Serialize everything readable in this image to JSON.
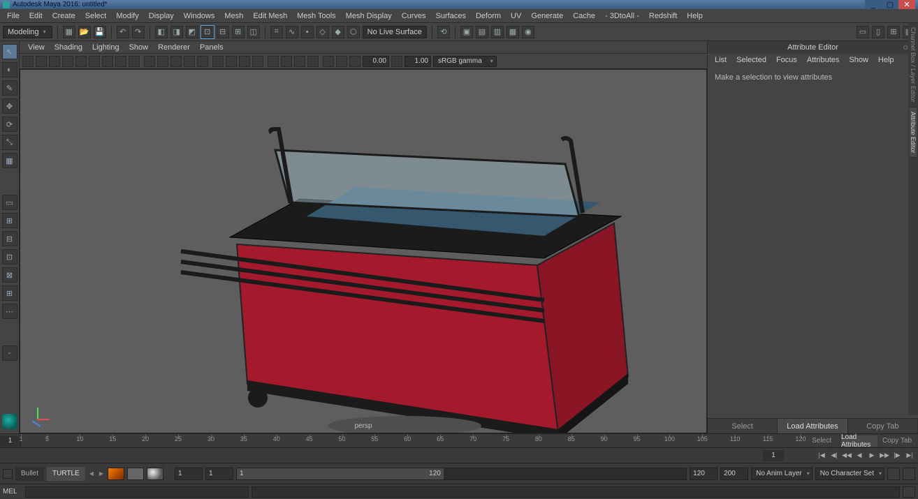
{
  "titlebar": {
    "title": "Autodesk Maya 2016: untitled*"
  },
  "mainmenu": [
    "File",
    "Edit",
    "Create",
    "Select",
    "Modify",
    "Display",
    "Windows",
    "Mesh",
    "Edit Mesh",
    "Mesh Tools",
    "Mesh Display",
    "Curves",
    "Surfaces",
    "Deform",
    "UV",
    "Generate",
    "Cache",
    "- 3DtoAll -",
    "Redshift",
    "Help"
  ],
  "shelf": {
    "mode": "Modeling",
    "live": "No Live Surface"
  },
  "panelmenu": [
    "View",
    "Shading",
    "Lighting",
    "Show",
    "Renderer",
    "Panels"
  ],
  "panelbar": {
    "num1": "0.00",
    "num2": "1.00",
    "colorspace": "sRGB gamma"
  },
  "viewport": {
    "camera": "persp"
  },
  "attr": {
    "title": "Attribute Editor",
    "menu": [
      "List",
      "Selected",
      "Focus",
      "Attributes",
      "Show",
      "Help"
    ],
    "message": "Make a selection to view attributes",
    "buttons": {
      "select": "Select",
      "load": "Load Attributes",
      "copy": "Copy Tab"
    }
  },
  "sidetabs": [
    "Channel Box / Layer Editor",
    "Attribute Editor"
  ],
  "timeslider": {
    "start_vis": "1",
    "ticks": [
      1,
      5,
      10,
      15,
      20,
      25,
      30,
      35,
      40,
      45,
      50,
      55,
      60,
      65,
      70,
      75,
      80,
      85,
      90,
      95,
      100,
      105,
      110,
      115,
      120
    ],
    "right": {
      "select": "Select",
      "load": "Load Attributes",
      "copy": "Copy Tab"
    }
  },
  "playback": {
    "curframe": "1"
  },
  "range": {
    "tabs": [
      "Bullet",
      "TURTLE"
    ],
    "start": "1",
    "end": "1",
    "range_start": "1",
    "range_end": "120",
    "outer_start": "120",
    "outer_end": "200",
    "animlayer": "No Anim Layer",
    "charset": "No Character Set"
  },
  "cmd": {
    "label": "MEL"
  }
}
